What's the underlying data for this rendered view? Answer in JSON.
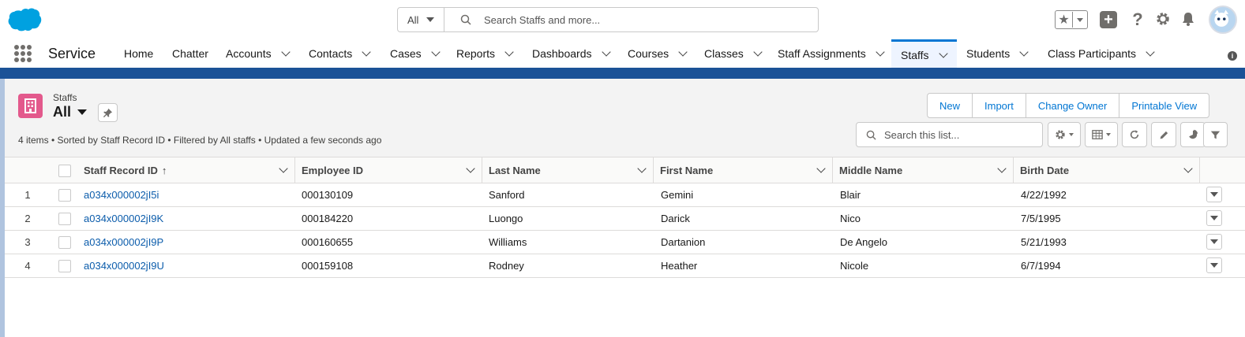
{
  "global_header": {
    "search_scope": "All",
    "search_placeholder": "Search Staffs and more..."
  },
  "nav": {
    "app_name": "Service",
    "items": [
      {
        "label": "Home",
        "dropdown": false
      },
      {
        "label": "Chatter",
        "dropdown": false
      },
      {
        "label": "Accounts",
        "dropdown": true
      },
      {
        "label": "Contacts",
        "dropdown": true
      },
      {
        "label": "Cases",
        "dropdown": true
      },
      {
        "label": "Reports",
        "dropdown": true
      },
      {
        "label": "Dashboards",
        "dropdown": true
      },
      {
        "label": "Courses",
        "dropdown": true
      },
      {
        "label": "Classes",
        "dropdown": true
      },
      {
        "label": "Staff Assignments",
        "dropdown": true
      },
      {
        "label": "Staffs",
        "dropdown": true,
        "active": true
      },
      {
        "label": "Students",
        "dropdown": true
      },
      {
        "label": "Class Participants",
        "dropdown": true
      }
    ]
  },
  "list_header": {
    "object_label": "Staffs",
    "view_name": "All",
    "meta": "4 items • Sorted by Staff Record ID • Filtered by All staffs • Updated a few seconds ago",
    "actions": [
      "New",
      "Import",
      "Change Owner",
      "Printable View"
    ],
    "search_placeholder": "Search this list..."
  },
  "table": {
    "columns": [
      "Staff Record ID",
      "Employee ID",
      "Last Name",
      "First Name",
      "Middle Name",
      "Birth Date"
    ],
    "sort_indicator": "↑",
    "rows": [
      {
        "num": "1",
        "record_id": "a034x000002jI5i",
        "employee_id": "000130109",
        "last_name": "Sanford",
        "first_name": "Gemini",
        "middle_name": "Blair",
        "birth_date": "4/22/1992"
      },
      {
        "num": "2",
        "record_id": "a034x000002jI9K",
        "employee_id": "000184220",
        "last_name": "Luongo",
        "first_name": "Darick",
        "middle_name": "Nico",
        "birth_date": "7/5/1995"
      },
      {
        "num": "3",
        "record_id": "a034x000002jI9P",
        "employee_id": "000160655",
        "last_name": "Williams",
        "first_name": "Dartanion",
        "middle_name": "De Angelo",
        "birth_date": "5/21/1993"
      },
      {
        "num": "4",
        "record_id": "a034x000002jI9U",
        "employee_id": "000159108",
        "last_name": "Rodney",
        "first_name": "Heather",
        "middle_name": "Nicole",
        "birth_date": "6/7/1994"
      }
    ]
  },
  "colors": {
    "brand": "#1b5297",
    "accent": "#0176d3",
    "link": "#0b5cab",
    "object_icon": "#e3598c",
    "logo": "#00a1e0"
  },
  "icons": [
    "salesforce-logo",
    "search-icon",
    "star-icon",
    "plus-icon",
    "help-icon",
    "gear-icon",
    "bell-icon",
    "app-launcher-icon",
    "building-icon",
    "pin-icon",
    "refresh-icon",
    "pencil-icon",
    "chart-icon",
    "filter-icon",
    "table-icon"
  ]
}
